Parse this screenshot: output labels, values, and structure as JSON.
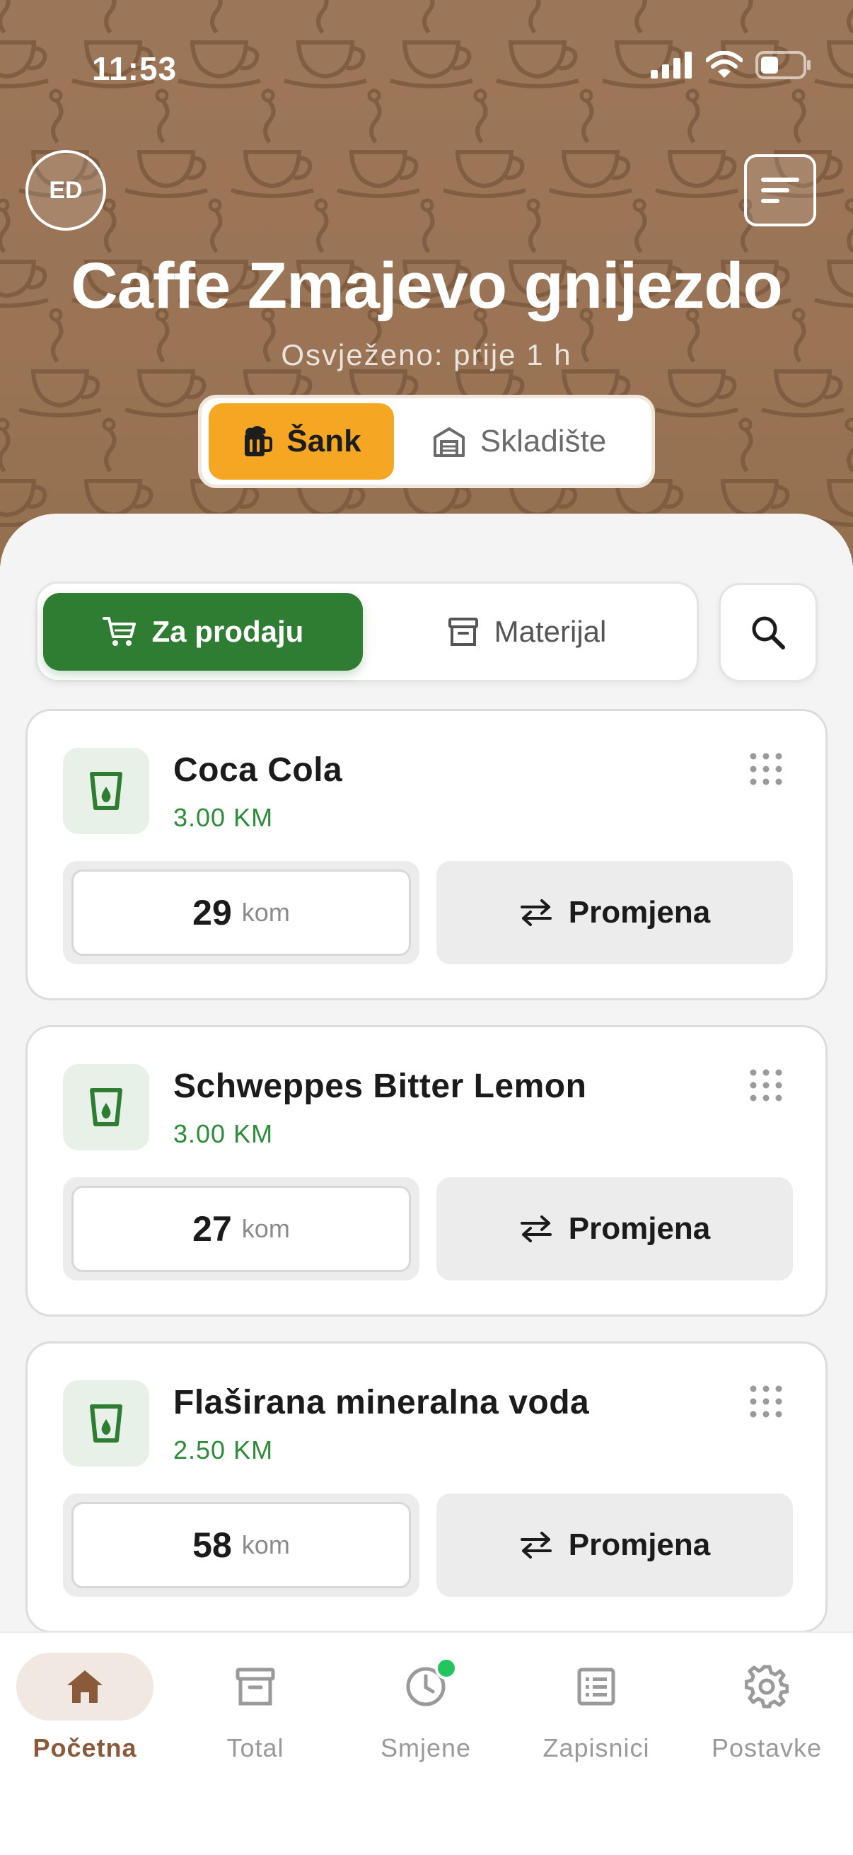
{
  "status_bar": {
    "time": "11:53"
  },
  "header": {
    "avatar_initials": "ED",
    "title": "Caffe Zmajevo gnijezdo",
    "subtitle": "Osvježeno: prije 1 h",
    "location_tabs": [
      {
        "label": "Šank",
        "icon": "beer-mug-icon",
        "active": true
      },
      {
        "label": "Skladište",
        "icon": "warehouse-icon",
        "active": false
      }
    ]
  },
  "mode_tabs": [
    {
      "label": "Za prodaju",
      "icon": "cart-icon",
      "active": true
    },
    {
      "label": "Materijal",
      "icon": "archive-box-icon",
      "active": false
    }
  ],
  "products": [
    {
      "name": "Coca Cola",
      "price": "3.00 KM",
      "quantity": "29",
      "unit": "kom",
      "action": "Promjena"
    },
    {
      "name": "Schweppes Bitter Lemon",
      "price": "3.00 KM",
      "quantity": "27",
      "unit": "kom",
      "action": "Promjena"
    },
    {
      "name": "Flaširana mineralna voda",
      "price": "2.50 KM",
      "quantity": "58",
      "unit": "kom",
      "action": "Promjena"
    }
  ],
  "nav": [
    {
      "label": "Početna",
      "icon": "home-icon",
      "active": true
    },
    {
      "label": "Total",
      "icon": "archive-icon",
      "active": false
    },
    {
      "label": "Smjene",
      "icon": "clock-icon",
      "active": false,
      "badge": true
    },
    {
      "label": "Zapisnici",
      "icon": "list-icon",
      "active": false
    },
    {
      "label": "Postavke",
      "icon": "gear-icon",
      "active": false
    }
  ],
  "colors": {
    "header_brown": "#9c7658",
    "accent_orange": "#f5a623",
    "accent_green": "#2e7d32",
    "price_green": "#2e8b3a",
    "nav_active": "#8a5a3b",
    "badge_green": "#22c55e"
  }
}
